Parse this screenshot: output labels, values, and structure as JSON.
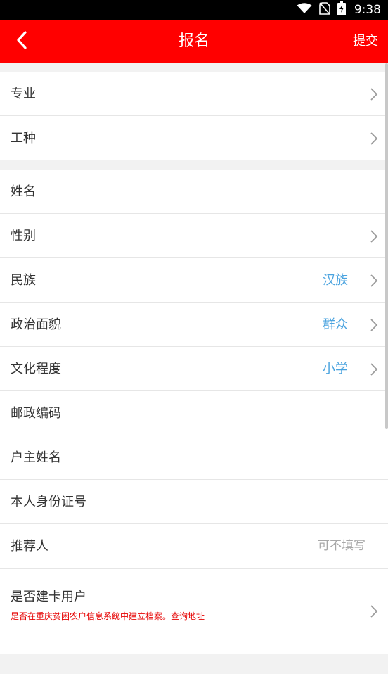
{
  "status_bar": {
    "time": "9:38",
    "icons": [
      "wifi-icon",
      "no-sim-icon",
      "battery-icon"
    ]
  },
  "header": {
    "title": "报名",
    "submit_label": "提交",
    "back_icon": "back-arrow-icon"
  },
  "colors": {
    "header_bg": "#ff0000",
    "value_text": "#4aa3df",
    "note_text": "#e60000",
    "placeholder_text": "#a8a8a8"
  },
  "group1": {
    "items": [
      {
        "label": "专业",
        "value": "",
        "has_chevron": true
      },
      {
        "label": "工种",
        "value": "",
        "has_chevron": true
      }
    ]
  },
  "group2": {
    "items": [
      {
        "label": "姓名",
        "value": "",
        "has_chevron": false
      },
      {
        "label": "性别",
        "value": "",
        "has_chevron": true
      },
      {
        "label": "民族",
        "value": "汉族",
        "has_chevron": true
      },
      {
        "label": "政治面貌",
        "value": "群众",
        "has_chevron": true
      },
      {
        "label": "文化程度",
        "value": "小学",
        "has_chevron": true
      },
      {
        "label": "邮政编码",
        "value": "",
        "has_chevron": false
      },
      {
        "label": "户主姓名",
        "value": "",
        "has_chevron": false
      },
      {
        "label": "本人身份证号",
        "value": "",
        "has_chevron": false
      },
      {
        "label": "推荐人",
        "placeholder": "可不填写",
        "has_chevron": false
      }
    ],
    "card_user": {
      "label": "是否建卡用户",
      "note": "是否在重庆贫困农户信息系统中建立档案。查询地址"
    }
  }
}
